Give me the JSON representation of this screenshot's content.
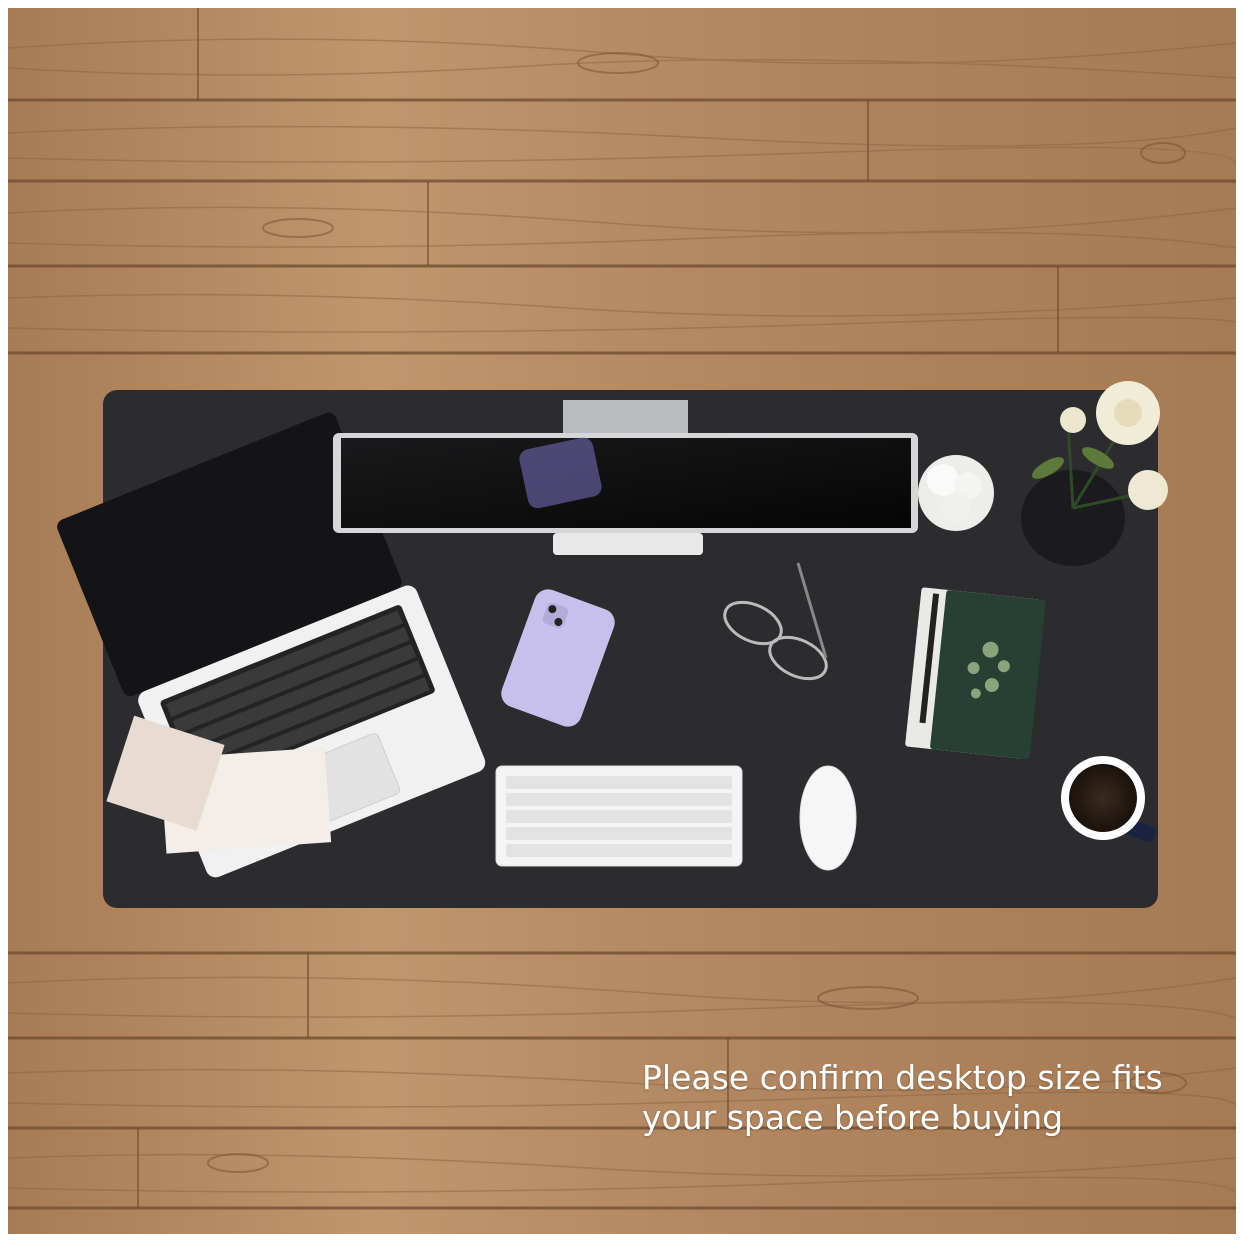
{
  "image": {
    "caption_line1": "Please confirm desktop size fits",
    "caption_line2": "your space before buying"
  },
  "colors": {
    "wood_light": "#b58a63",
    "wood_dark": "#8f6645",
    "wood_seam": "#6e4a2f",
    "desk_mat": "#2c2c2e",
    "caption_text": "#ffffff"
  }
}
